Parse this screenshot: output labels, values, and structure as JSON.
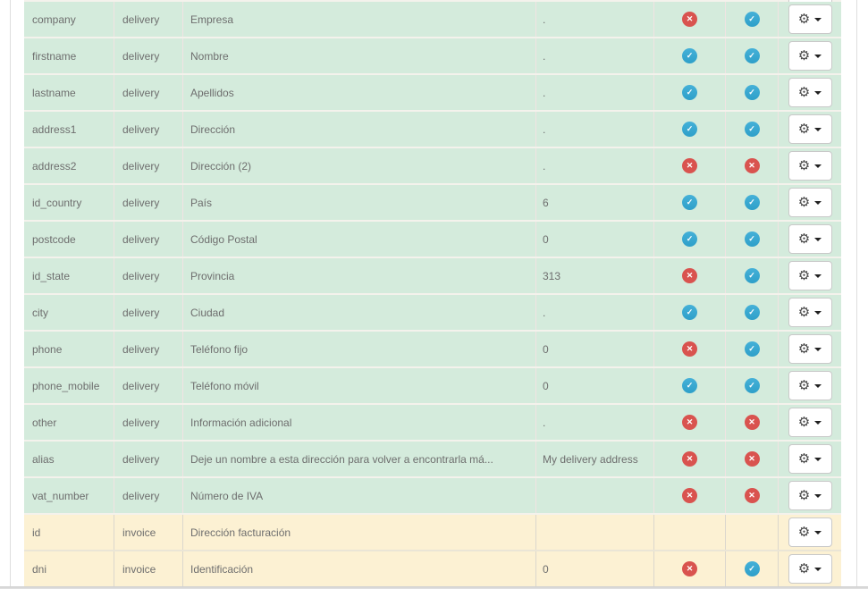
{
  "colors": {
    "row-delivery-bg": "#d4ebdc",
    "row-invoice-bg": "#fcf1d3",
    "check-blue": "#45b1d8",
    "cross-red": "#d9534f",
    "text-gray": "#6e6e6e"
  },
  "icons": {
    "gear": "⚙",
    "check": "✓",
    "cross": "✕"
  },
  "table": {
    "rows": [
      {
        "field": "company",
        "type": "delivery",
        "label": "Empresa",
        "value": ".",
        "icon1": "cross",
        "icon2": "check"
      },
      {
        "field": "firstname",
        "type": "delivery",
        "label": "Nombre",
        "value": ".",
        "icon1": "check",
        "icon2": "check"
      },
      {
        "field": "lastname",
        "type": "delivery",
        "label": "Apellidos",
        "value": ".",
        "icon1": "check",
        "icon2": "check"
      },
      {
        "field": "address1",
        "type": "delivery",
        "label": "Dirección",
        "value": ".",
        "icon1": "check",
        "icon2": "check"
      },
      {
        "field": "address2",
        "type": "delivery",
        "label": "Dirección (2)",
        "value": ".",
        "icon1": "cross",
        "icon2": "cross"
      },
      {
        "field": "id_country",
        "type": "delivery",
        "label": "País",
        "value": "6",
        "icon1": "check",
        "icon2": "check"
      },
      {
        "field": "postcode",
        "type": "delivery",
        "label": "Código Postal",
        "value": "0",
        "icon1": "check",
        "icon2": "check"
      },
      {
        "field": "id_state",
        "type": "delivery",
        "label": "Provincia",
        "value": "313",
        "icon1": "cross",
        "icon2": "check"
      },
      {
        "field": "city",
        "type": "delivery",
        "label": "Ciudad",
        "value": ".",
        "icon1": "check",
        "icon2": "check"
      },
      {
        "field": "phone",
        "type": "delivery",
        "label": "Teléfono fijo",
        "value": "0",
        "icon1": "cross",
        "icon2": "check"
      },
      {
        "field": "phone_mobile",
        "type": "delivery",
        "label": "Teléfono móvil",
        "value": "0",
        "icon1": "check",
        "icon2": "check"
      },
      {
        "field": "other",
        "type": "delivery",
        "label": "Información adicional",
        "value": ".",
        "icon1": "cross",
        "icon2": "cross"
      },
      {
        "field": "alias",
        "type": "delivery",
        "label": "Deje un nombre a esta dirección para volver a encontrarla má...",
        "value": "My delivery address",
        "icon1": "cross",
        "icon2": "cross"
      },
      {
        "field": "vat_number",
        "type": "delivery",
        "label": "Número de IVA",
        "value": "",
        "icon1": "none",
        "icon2": "none",
        "force_cross": true
      },
      {
        "field": "id",
        "type": "invoice",
        "label": "Dirección facturación",
        "value": "",
        "icon1": "none",
        "icon2": "none"
      },
      {
        "field": "dni",
        "type": "invoice",
        "label": "Identificación",
        "value": "0",
        "icon1": "cross",
        "icon2": "check"
      }
    ]
  }
}
